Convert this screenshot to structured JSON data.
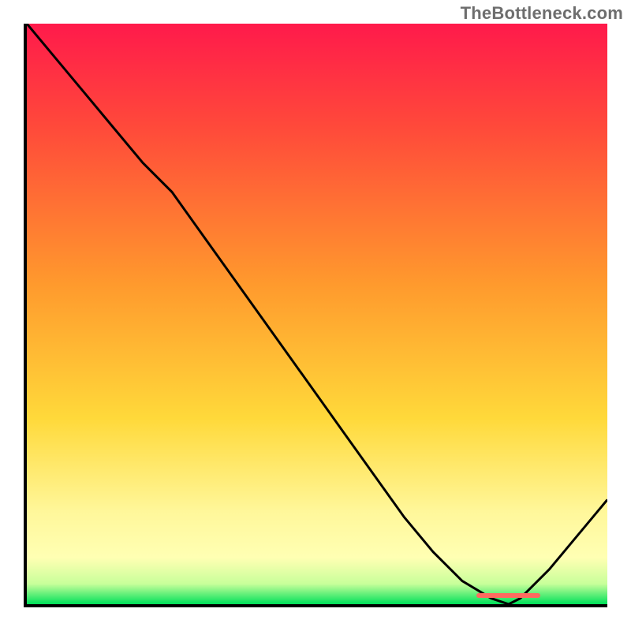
{
  "watermark": "TheBottleneck.com",
  "colors": {
    "top": "#ff1a4b",
    "mid_red": "#ff4a3a",
    "orange": "#ff9a2d",
    "yellow_mid": "#ffd93a",
    "yellow_pale": "#fff79a",
    "yellow_light": "#ffffb3",
    "green_light": "#c8ff9a",
    "green": "#00e05a",
    "marker": "#ff6b5f",
    "curve": "#000000"
  },
  "marker": {
    "x_frac_start": 0.775,
    "x_frac_end": 0.885,
    "y_frac": 0.985
  },
  "chart_data": {
    "type": "line",
    "title": "",
    "xlabel": "",
    "ylabel": "",
    "xlim": [
      0,
      100
    ],
    "ylim": [
      0,
      100
    ],
    "series": [
      {
        "name": "bottleneck-curve",
        "x": [
          0,
          5,
          10,
          15,
          20,
          25,
          30,
          35,
          40,
          45,
          50,
          55,
          60,
          65,
          70,
          75,
          80,
          83,
          85,
          90,
          95,
          100
        ],
        "y": [
          100,
          94,
          88,
          82,
          76,
          71,
          64,
          57,
          50,
          43,
          36,
          29,
          22,
          15,
          9,
          4,
          1,
          0,
          1,
          6,
          12,
          18
        ]
      }
    ],
    "optimal_x_range": [
      77.5,
      88.5
    ],
    "annotations": [
      {
        "text": "TheBottleneck.com",
        "role": "watermark"
      }
    ],
    "background_gradient_stops": [
      {
        "pos": 0.0,
        "color": "#ff1a4b"
      },
      {
        "pos": 0.18,
        "color": "#ff4a3a"
      },
      {
        "pos": 0.45,
        "color": "#ff9a2d"
      },
      {
        "pos": 0.68,
        "color": "#ffd93a"
      },
      {
        "pos": 0.84,
        "color": "#fff79a"
      },
      {
        "pos": 0.92,
        "color": "#ffffb3"
      },
      {
        "pos": 0.965,
        "color": "#c8ff9a"
      },
      {
        "pos": 1.0,
        "color": "#00e05a"
      }
    ]
  }
}
